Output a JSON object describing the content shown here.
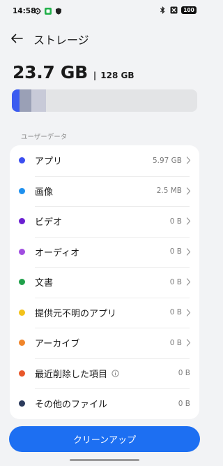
{
  "status_bar": {
    "time": "14:58",
    "left_icons": [
      "settings-gear-icon",
      "green-app-icon",
      "shield-icon"
    ],
    "right_icons": [
      "bluetooth-icon",
      "no-sim-icon"
    ],
    "battery": "100"
  },
  "header": {
    "back_icon": "arrow-left-icon",
    "title": "ストレージ"
  },
  "storage": {
    "used": "23.7 GB",
    "separator": "|",
    "total": "128 GB",
    "bar_segments": [
      {
        "name": "apps",
        "fraction": 0.04,
        "color": "#3b5bf0"
      },
      {
        "name": "system-a",
        "fraction": 0.065,
        "color": "#9aa0b6"
      },
      {
        "name": "system-b",
        "fraction": 0.08,
        "color": "#c8cad8"
      }
    ]
  },
  "section_label": "ユーザーデータ",
  "items": [
    {
      "label": "アプリ",
      "value": "5.97 GB",
      "color": "#3b4ef0",
      "chevron": true,
      "info": false
    },
    {
      "label": "画像",
      "value": "2.5 MB",
      "color": "#1e90ee",
      "chevron": true,
      "info": false
    },
    {
      "label": "ビデオ",
      "value": "0 B",
      "color": "#6a1fd1",
      "chevron": true,
      "info": false
    },
    {
      "label": "オーディオ",
      "value": "0 B",
      "color": "#a04de0",
      "chevron": true,
      "info": false
    },
    {
      "label": "文書",
      "value": "0 B",
      "color": "#20a04a",
      "chevron": true,
      "info": false
    },
    {
      "label": "提供元不明のアプリ",
      "value": "0 B",
      "color": "#f3c21a",
      "chevron": true,
      "info": false
    },
    {
      "label": "アーカイブ",
      "value": "0 B",
      "color": "#f0852a",
      "chevron": true,
      "info": false
    },
    {
      "label": "最近削除した項目",
      "value": "0 B",
      "color": "#e8572a",
      "chevron": false,
      "info": true
    },
    {
      "label": "その他のファイル",
      "value": "0 B",
      "color": "#2b3a5c",
      "chevron": false,
      "info": false
    }
  ],
  "cleanup_button": "クリーンアップ"
}
